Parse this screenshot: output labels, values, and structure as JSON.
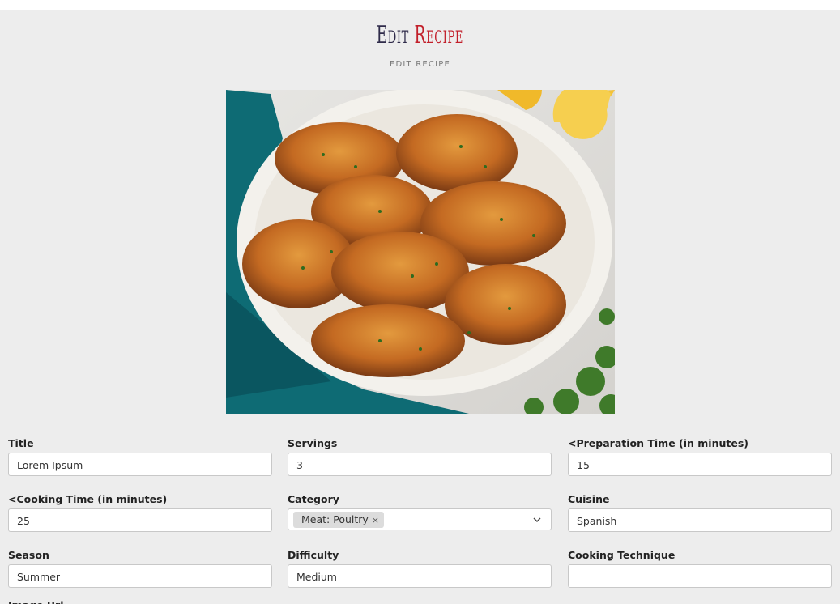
{
  "header": {
    "title_word1": "Edit",
    "title_word2": "Recipe",
    "subtitle": "EDIT RECIPE"
  },
  "image": {
    "icon": "recipe-photo-chicken-thighs"
  },
  "form": {
    "title": {
      "label": "Title",
      "value": "Lorem Ipsum"
    },
    "servings": {
      "label": "Servings",
      "value": "3"
    },
    "prep_time": {
      "label": "<Preparation Time (in minutes)",
      "value": "15"
    },
    "cooking_time": {
      "label": "<Cooking Time (in minutes)",
      "value": "25"
    },
    "category": {
      "label": "Category",
      "chip": "Meat: Poultry",
      "chip_remove": "×"
    },
    "cuisine": {
      "label": "Cuisine",
      "value": "Spanish"
    },
    "season": {
      "label": "Season",
      "value": "Summer"
    },
    "difficulty": {
      "label": "Difficulty",
      "value": "Medium"
    },
    "technique": {
      "label": "Cooking Technique",
      "value": ""
    },
    "image_url": {
      "label": "Image Url"
    }
  },
  "colors": {
    "background": "#ededed",
    "title_dark": "#2f2b4a",
    "title_accent": "#c21f2a"
  }
}
